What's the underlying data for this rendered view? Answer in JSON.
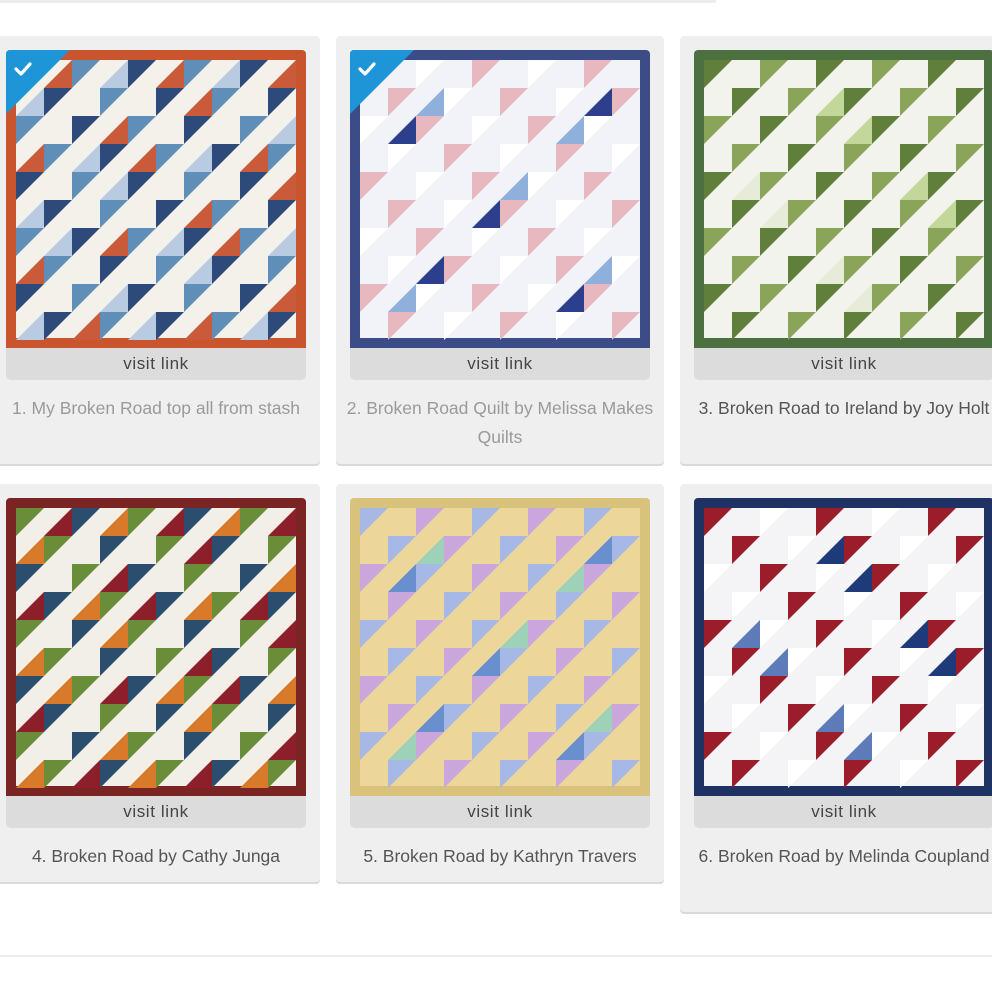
{
  "page": {
    "visit_label": "visit link"
  },
  "cards": [
    {
      "caption": "1. My Broken Road top all from stash",
      "checked": true,
      "visited": true,
      "photo": {
        "name": "quilt-photo-1",
        "bg": "#f4f0ea",
        "border": "#c8552e",
        "accent": [
          "#2e4a7a",
          "#c95a3a",
          "#5f8fb8",
          "#b9cbe0"
        ]
      }
    },
    {
      "caption": "2. Broken Road Quilt by Melissa Makes Quilts",
      "checked": true,
      "visited": true,
      "photo": {
        "name": "quilt-photo-2",
        "bg": "#f2f3f8",
        "border": "#3c4c86",
        "accent": [
          "#2c3f8c",
          "#e8b8c0",
          "#8fb0da",
          "#ffffff"
        ]
      }
    },
    {
      "caption": "3. Broken Road to Ireland by Joy Holt",
      "checked": false,
      "visited": false,
      "photo": {
        "name": "quilt-photo-3",
        "bg": "#f3f3ee",
        "border": "#4c7040",
        "accent": [
          "#8aa45a",
          "#c4d79a",
          "#5f7f3a",
          "#e7ecd8"
        ]
      }
    },
    {
      "caption": "4. Broken Road by Cathy Junga",
      "checked": false,
      "visited": false,
      "photo": {
        "name": "quilt-photo-4",
        "bg": "#f2efe9",
        "border": "#7a2424",
        "accent": [
          "#8d1f2b",
          "#2b4d6e",
          "#d87a2a",
          "#6a8d3a"
        ]
      }
    },
    {
      "caption": "5. Broken Road by Kathryn Travers",
      "checked": false,
      "visited": false,
      "photo": {
        "name": "quilt-photo-5",
        "bg": "#ecd69a",
        "border": "#d9c27c",
        "accent": [
          "#a6b8e6",
          "#9fd0b8",
          "#c9a7dd",
          "#6a8fcf"
        ]
      }
    },
    {
      "caption": "6. Broken Road by Melinda Coupland",
      "checked": false,
      "visited": false,
      "photo": {
        "name": "quilt-photo-6",
        "bg": "#f4f4f6",
        "border": "#1f3264",
        "accent": [
          "#1f3a78",
          "#9b1d2b",
          "#5c7bb8",
          "#ffffff"
        ]
      }
    }
  ]
}
